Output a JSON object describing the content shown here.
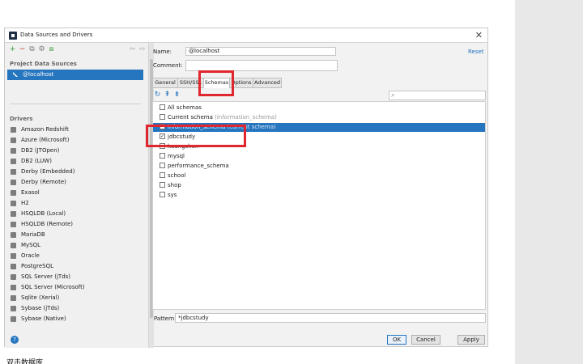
{
  "window": {
    "title": "Data Sources and Drivers",
    "close": "✕"
  },
  "left_panel": {
    "toolbar": [
      {
        "icon": "add-icon",
        "glyph": "+"
      },
      {
        "icon": "remove-icon",
        "glyph": "−"
      },
      {
        "icon": "copy-icon",
        "glyph": "⧉"
      },
      {
        "icon": "settings-icon",
        "glyph": "⚙"
      },
      {
        "icon": "link-icon",
        "glyph": "⧈"
      },
      {
        "icon": "back-icon",
        "glyph": "⇦"
      },
      {
        "icon": "forward-icon",
        "glyph": "⇨"
      }
    ],
    "project_sources_label": "Project Data Sources",
    "selected_source": "@localhost",
    "drivers_label": "Drivers",
    "drivers": [
      "Amazon Redshift",
      "Azure (Microsoft)",
      "DB2 (JTOpen)",
      "DB2 (LUW)",
      "Derby (Embedded)",
      "Derby (Remote)",
      "Exasol",
      "H2",
      "HSQLDB (Local)",
      "HSQLDB (Remote)",
      "MariaDB",
      "MySQL",
      "Oracle",
      "PostgreSQL",
      "SQL Server (jTds)",
      "SQL Server (Microsoft)",
      "Sqlite (Xerial)",
      "Sybase (jTds)",
      "Sybase (Native)"
    ],
    "help": "?"
  },
  "form": {
    "name_label": "Name:",
    "name_value": "@localhost",
    "comment_label": "Comment:",
    "comment_value": "",
    "reset": "Reset"
  },
  "tabs": [
    "General",
    "SSH/SSL",
    "Schemas",
    "Options",
    "Advanced"
  ],
  "active_tab": "Schemas",
  "schema_toolbar": [
    {
      "icon": "refresh-icon",
      "glyph": "↻"
    },
    {
      "icon": "collapse-icon",
      "glyph": "⇞"
    },
    {
      "icon": "expand-icon",
      "glyph": "⇟"
    }
  ],
  "search_placeholder": "",
  "schemas": [
    {
      "name": "All schemas",
      "note": "",
      "checked": false,
      "selected": false
    },
    {
      "name": "Current schema",
      "note": "(information_schema)",
      "checked": false,
      "selected": false
    },
    {
      "name": "information_schema",
      "note": "(current schema)",
      "checked": false,
      "selected": true
    },
    {
      "name": "jdbcstudy",
      "note": "",
      "checked": true,
      "selected": false
    },
    {
      "name": "kuangshen",
      "note": "",
      "checked": false,
      "selected": false
    },
    {
      "name": "mysql",
      "note": "",
      "checked": false,
      "selected": false
    },
    {
      "name": "performance_schema",
      "note": "",
      "checked": false,
      "selected": false
    },
    {
      "name": "school",
      "note": "",
      "checked": false,
      "selected": false
    },
    {
      "name": "shop",
      "note": "",
      "checked": false,
      "selected": false
    },
    {
      "name": "sys",
      "note": "",
      "checked": false,
      "selected": false
    }
  ],
  "pattern": {
    "label": "Pattern:",
    "value": "*jdbcstudy"
  },
  "buttons": {
    "ok": "OK",
    "cancel": "Cancel",
    "apply": "Apply"
  },
  "caption": "双击数据库",
  "colors": {
    "accent": "#2675bf",
    "highlight": "#e0262e"
  }
}
